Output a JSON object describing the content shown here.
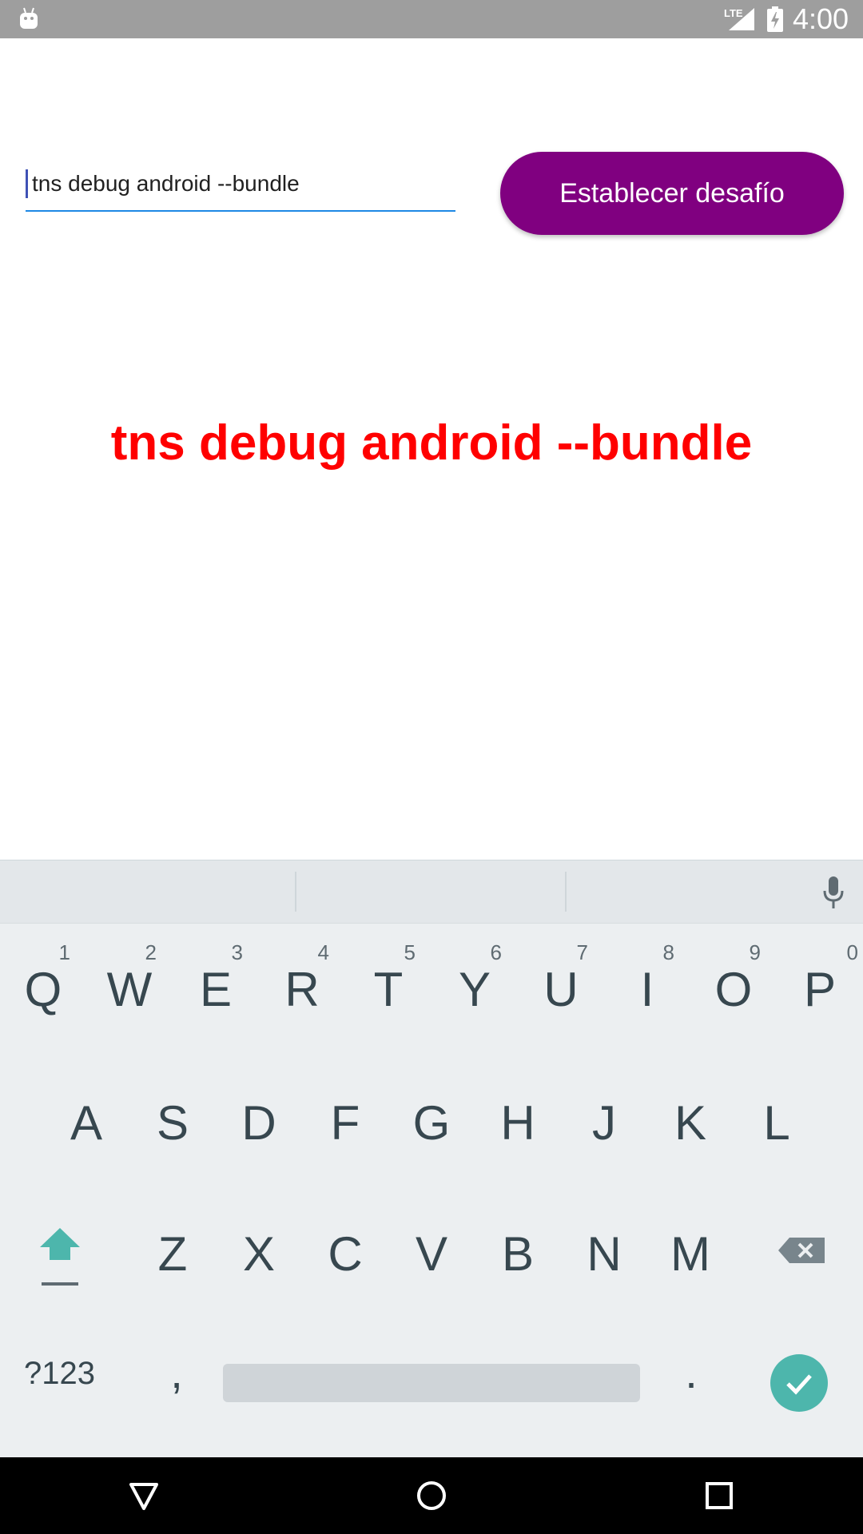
{
  "status_bar": {
    "time": "4:00",
    "network_label": "LTE",
    "icons": [
      "android-app-icon",
      "signal-icon",
      "battery-charging-icon"
    ]
  },
  "form": {
    "input_value": "tns debug android --bundle",
    "button_label": "Establecer desafío"
  },
  "result": {
    "text": "tns debug android --bundle",
    "color": "#ff0000"
  },
  "keyboard": {
    "row1": [
      {
        "key": "Q",
        "hint": "1"
      },
      {
        "key": "W",
        "hint": "2"
      },
      {
        "key": "E",
        "hint": "3"
      },
      {
        "key": "R",
        "hint": "4"
      },
      {
        "key": "T",
        "hint": "5"
      },
      {
        "key": "Y",
        "hint": "6"
      },
      {
        "key": "U",
        "hint": "7"
      },
      {
        "key": "I",
        "hint": "8"
      },
      {
        "key": "O",
        "hint": "9"
      },
      {
        "key": "P",
        "hint": "0"
      }
    ],
    "row2": [
      "A",
      "S",
      "D",
      "F",
      "G",
      "H",
      "J",
      "K",
      "L"
    ],
    "row3": [
      "Z",
      "X",
      "C",
      "V",
      "B",
      "N",
      "M"
    ],
    "symbols_label": "?123",
    "comma": ",",
    "period": ".",
    "icons": [
      "mic-icon",
      "shift-icon",
      "backspace-icon",
      "enter-check-icon"
    ],
    "accent_color": "#4db6ac"
  },
  "nav_bar": {
    "icons": [
      "back-icon",
      "home-icon",
      "recents-icon"
    ]
  },
  "colors": {
    "button_background": "#800080",
    "input_underline": "#1e88e5",
    "status_bar": "#9e9e9e"
  }
}
